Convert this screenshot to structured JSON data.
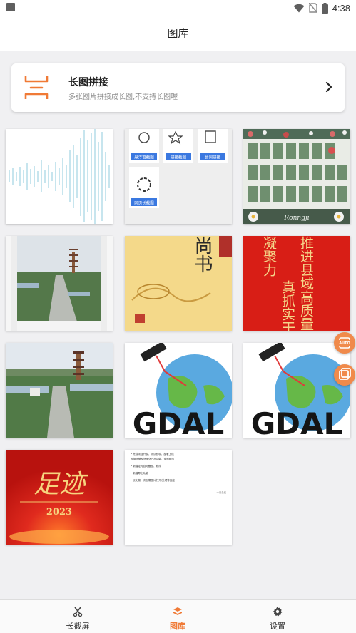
{
  "status_bar": {
    "time": "4:38"
  },
  "header": {
    "title": "图库"
  },
  "long_image_card": {
    "title": "长图拼接",
    "subtitle": "多张图片拼接成长图,不支持长图喔",
    "accent": "#f07a36"
  },
  "gallery": {
    "tile_0_buttons": [
      "悬浮窗截图",
      "拼接截图",
      "台词拼接",
      "网页长截图"
    ],
    "tile_2_signature": "Ronngji",
    "tile_4_text": "尚书",
    "tile_5_text": [
      "凝聚力",
      "真抓实干",
      "推进县域高质量发"
    ],
    "tile_6_text": "GDAL",
    "tile_7_text": "GDAL",
    "tile_8_text": [
      "足迹",
      "2023"
    ],
    "tile_9_lines": [
      "• 完成项目开发、测试验收、部署上线",
      "  根据运营反馈优化产品功能、体验细节",
      "• 新增定时自动截图、修改",
      "• 新增导出功能",
      "• 优化第一次加载图片打开/处理等速度"
    ],
    "tile_9_footer": "一月总结"
  },
  "floating_buttons": {
    "auto": "AUTO"
  },
  "bottom_nav": {
    "items": [
      {
        "label": "长截屏",
        "icon": "scissors-icon"
      },
      {
        "label": "图库",
        "icon": "layers-icon"
      },
      {
        "label": "设置",
        "icon": "gear-icon"
      }
    ],
    "active": 1,
    "active_color": "#f07a36"
  }
}
